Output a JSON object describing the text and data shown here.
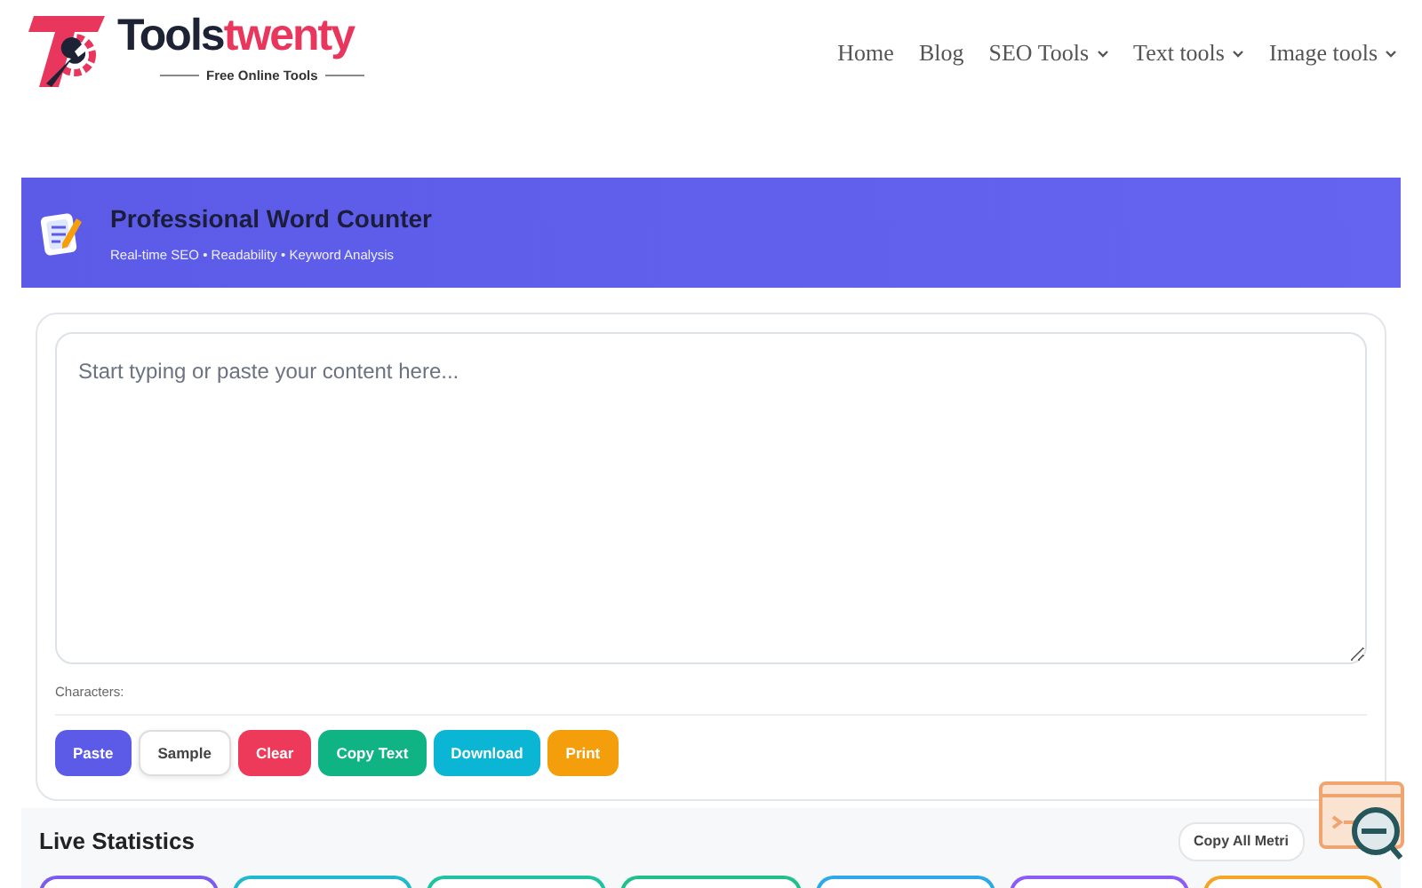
{
  "brand": {
    "name_dark": "Tools",
    "name_accent": "twenty",
    "tagline": "Free Online Tools"
  },
  "nav": [
    {
      "label": "Home",
      "dropdown": false
    },
    {
      "label": "Blog",
      "dropdown": false
    },
    {
      "label": "SEO Tools",
      "dropdown": true
    },
    {
      "label": "Text tools",
      "dropdown": true
    },
    {
      "label": "Image tools",
      "dropdown": true
    }
  ],
  "banner": {
    "title": "Professional Word Counter",
    "subtitle": "Real-time SEO • Readability • Keyword Analysis"
  },
  "editor": {
    "placeholder": "Start typing or paste your content here...",
    "counter_label": "Characters:"
  },
  "buttons": [
    {
      "label": "Paste",
      "color": "#5b5be8"
    },
    {
      "label": "Sample",
      "color": "#ffffff"
    },
    {
      "label": "Clear",
      "color": "#ee3a5a"
    },
    {
      "label": "Copy Text",
      "color": "#10b383"
    },
    {
      "label": "Download",
      "color": "#0bb5d4"
    },
    {
      "label": "Print",
      "color": "#f59e0b"
    }
  ],
  "stats": {
    "title": "Live Statistics",
    "copy_button": "Copy All Metri",
    "cards": [
      {
        "color": "#7c5cf0"
      },
      {
        "color": "#22b8cf"
      },
      {
        "color": "#20c3a0"
      },
      {
        "color": "#20c08a"
      },
      {
        "color": "#2ea8e8"
      },
      {
        "color": "#8b5cf6"
      },
      {
        "color": "#f5a524"
      }
    ]
  }
}
